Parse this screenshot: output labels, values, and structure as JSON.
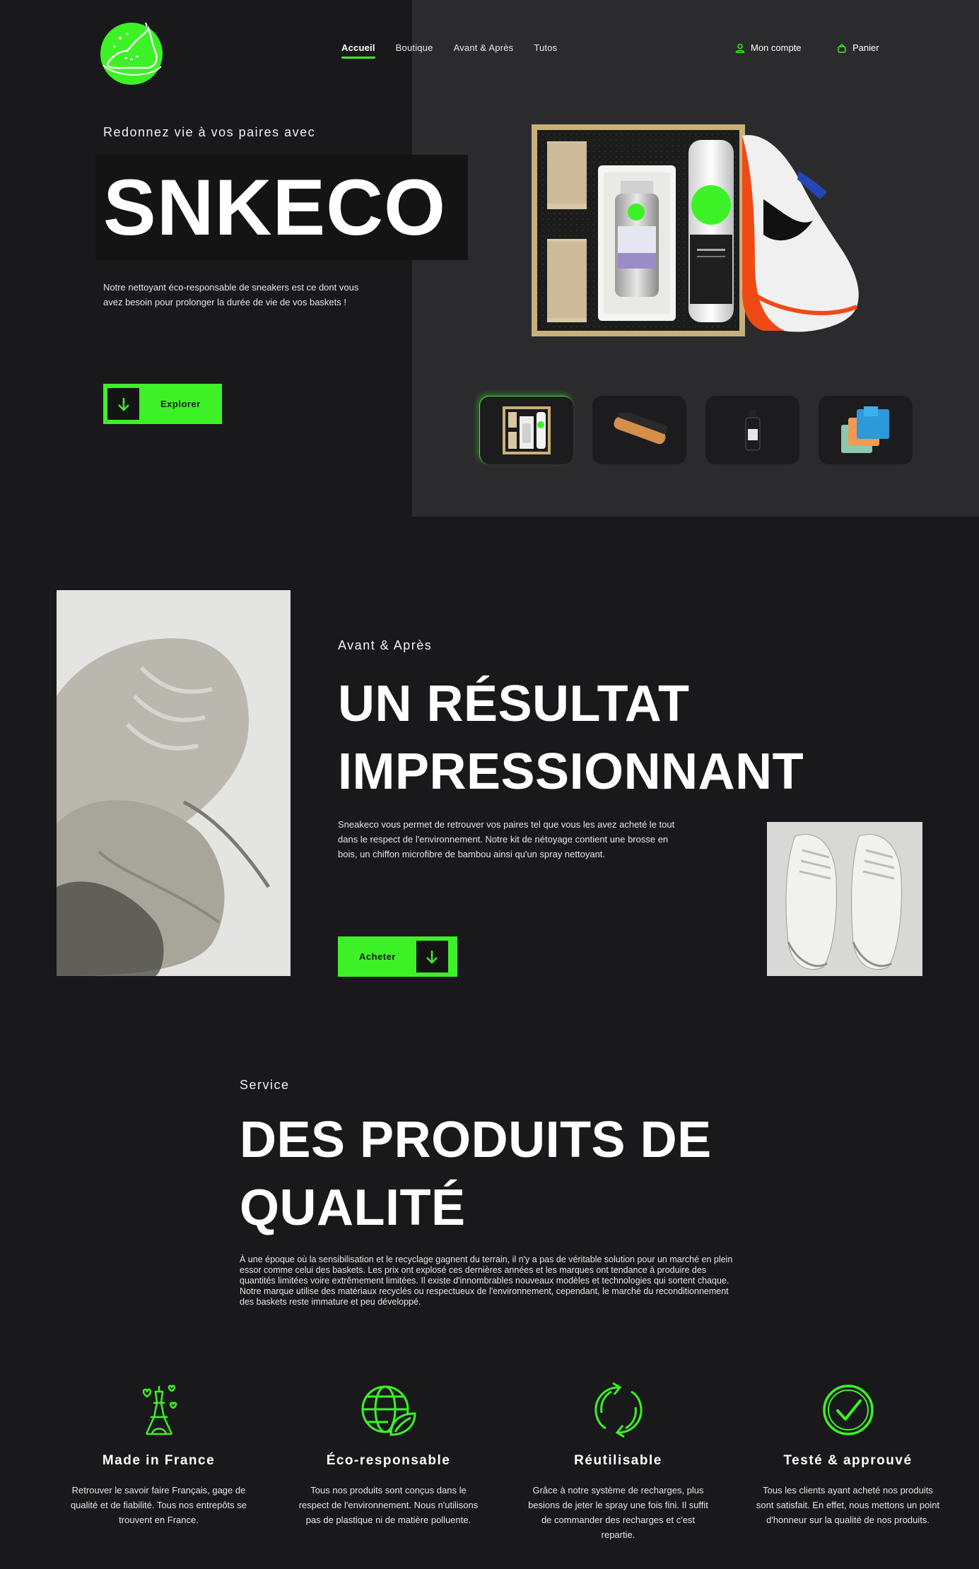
{
  "colors": {
    "accent": "#3cf227",
    "background": "#19191b",
    "panel": "#2b2b2d"
  },
  "nav": {
    "items": [
      {
        "label": "Accueil",
        "active": true
      },
      {
        "label": "Boutique"
      },
      {
        "label": "Avant & Après"
      },
      {
        "label": "Tutos"
      }
    ],
    "account_label": "Mon compte",
    "account_icon": "user-icon",
    "cart_label": "Panier",
    "cart_icon": "basket-icon"
  },
  "hero": {
    "kicker": "Redonnez vie à vos paires avec",
    "title": "SNKECO",
    "description": "Notre nettoyant éco-responsable de sneakers est ce dont vous avez besoin pour prolonger la durée de vie de vos baskets !",
    "button_label": "Explorer",
    "button_icon": "arrow-down-icon",
    "thumbnails": [
      {
        "name": "kit-box",
        "active": true
      },
      {
        "name": "wooden-brush"
      },
      {
        "name": "spray-bottle"
      },
      {
        "name": "microfiber-cloths"
      }
    ]
  },
  "before_after": {
    "kicker": "Avant & Après",
    "title_line1": "UN RÉSULTAT",
    "title_line2": "IMPRESSIONNANT",
    "description": "Sneakeco vous permet de retrouver vos paires tel que vous les avez acheté le tout dans le respect de l'environnement. Notre kit de nétoyage contient une brosse en bois, un chiffon microfibre de bambou ainsi qu'un spray nettoyant.",
    "button_label": "Acheter",
    "button_icon": "arrow-down-icon"
  },
  "service": {
    "kicker": "Service",
    "title_line1": "DES PRODUITS DE",
    "title_line2": "QUALITÉ",
    "description": "À une époque où la sensibilisation et le recyclage gagnent du terrain, il n'y a pas de véritable solution pour un marché en plein essor comme celui des baskets. Les prix ont explosé ces dernières années et les marques ont tendance à produire des quantités limitées voire extrêmement limitées. Il existe d'innombrables nouveaux modèles et technologies qui sortent chaque. Notre marque utilise des matériaux recyclés ou respectueux de l'environnement, cependant, le marché du reconditionnement des baskets reste immature et peu développé."
  },
  "features": [
    {
      "icon": "eiffel-tower-icon",
      "title": "Made in France",
      "text": "Retrouver le savoir faire Français, gage de qualité et de fiabilité. Tous nos entrepôts se trouvent en France."
    },
    {
      "icon": "eco-globe-icon",
      "title": "Éco-responsable",
      "text": "Tous nos produits sont conçus dans le respect de l'environnement. Nous n'utilisons pas de plastique ni de matière polluente."
    },
    {
      "icon": "recycle-icon",
      "title": "Réutilisable",
      "text": "Grâce à notre système de recharges, plus besions de jeter le spray une fois fini. Il suffit de commander des recharges et c'est repartie."
    },
    {
      "icon": "check-circle-icon",
      "title": "Testé & approuvé",
      "text": "Tous les clients ayant acheté nos produits sont satisfait. En effet, nous mettons un point d'honneur sur la qualité de nos produits."
    }
  ]
}
